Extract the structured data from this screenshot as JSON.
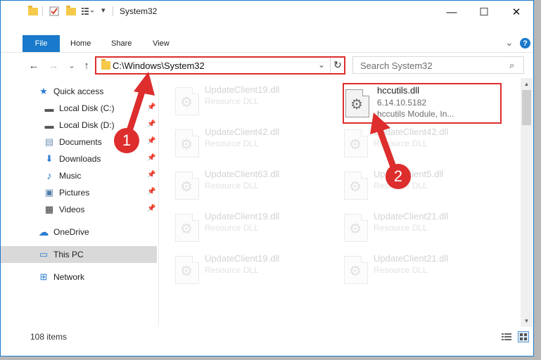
{
  "window": {
    "title": "System32",
    "minimize_glyph": "—",
    "maximize_glyph": "☐",
    "close_glyph": "✕"
  },
  "ribbon": {
    "file": "File",
    "tabs": [
      "Home",
      "Share",
      "View"
    ],
    "expand_glyph": "⌄",
    "help_glyph": "?"
  },
  "nav": {
    "back_glyph": "←",
    "forward_glyph": "→",
    "recent_glyph": "⌄",
    "up_glyph": "↑"
  },
  "address": {
    "path": "C:\\Windows\\System32",
    "dropdown_glyph": "⌄",
    "refresh_glyph": "↻"
  },
  "search": {
    "placeholder": "Search System32",
    "icon_glyph": "⌕"
  },
  "sidebar": {
    "items": [
      {
        "label": "Quick access",
        "icon": "star-icon",
        "glyph": "★",
        "color": "#2b7cd3"
      },
      {
        "label": "Local Disk (C:)",
        "icon": "drive-icon",
        "glyph": "▬",
        "color": "#555555",
        "pinned": true
      },
      {
        "label": "Local Disk (D:)",
        "icon": "drive-icon",
        "glyph": "▬",
        "color": "#555555",
        "pinned": true
      },
      {
        "label": "Documents",
        "icon": "documents-icon",
        "glyph": "▤",
        "color": "#6f8fb3",
        "pinned": true
      },
      {
        "label": "Downloads",
        "icon": "download-icon",
        "glyph": "⬇",
        "color": "#2b7cd3",
        "pinned": true
      },
      {
        "label": "Music",
        "icon": "music-icon",
        "glyph": "♪",
        "color": "#2b7cd3",
        "pinned": true
      },
      {
        "label": "Pictures",
        "icon": "pictures-icon",
        "glyph": "▣",
        "color": "#4f7aa8",
        "pinned": true
      },
      {
        "label": "Videos",
        "icon": "video-icon",
        "glyph": "▦",
        "color": "#333333",
        "pinned": true
      },
      {
        "label": "OneDrive",
        "icon": "cloud-icon",
        "glyph": "☁",
        "color": "#2b7cd3"
      },
      {
        "label": "This PC",
        "icon": "computer-icon",
        "glyph": "▭",
        "color": "#2b7cd3",
        "selected": true
      },
      {
        "label": "Network",
        "icon": "network-icon",
        "glyph": "⊞",
        "color": "#2b7cd3"
      }
    ],
    "pin_glyph": "📌"
  },
  "files": {
    "highlighted": {
      "name": "hccutils.dll",
      "version": "6.14.10.5182",
      "description": "hccutils Module, In..."
    },
    "faded": [
      {
        "name": "UpdateClient19.dll",
        "desc": "Resource DLL"
      },
      {
        "name": "UpdateClient42.dll",
        "desc": "Resource DLL"
      },
      {
        "name": "UpdateClient42.dll",
        "desc": "Resource DLL"
      },
      {
        "name": "UpdateClient63.dll",
        "desc": "Resource DLL"
      },
      {
        "name": "UpdateClient5.dll",
        "desc": "Resource DLL"
      },
      {
        "name": "UpdateClient19.dll",
        "desc": "Resource DLL"
      },
      {
        "name": "UpdateClient21.dll",
        "desc": "Resource DLL"
      },
      {
        "name": "UpdateClient19.dll",
        "desc": "Resource DLL"
      },
      {
        "name": "UpdateClient21.dll",
        "desc": "Resource DLL"
      }
    ],
    "gear_glyph": "⚙"
  },
  "status": {
    "item_count": "108 items"
  },
  "annotations": {
    "badge_1": "1",
    "badge_2": "2",
    "color": "#dd2d2d"
  }
}
